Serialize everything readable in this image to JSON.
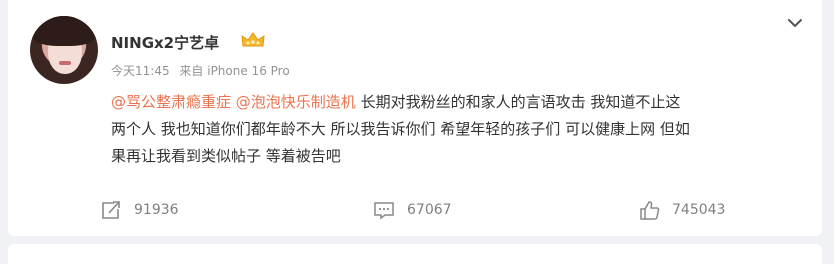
{
  "post": {
    "username": "NINGx2宁艺卓",
    "time": "今天11:45",
    "source": "来自 iPhone 16 Pro",
    "mention1": "@骂公整肃瘾重症",
    "mention2": "@泡泡快乐制造机",
    "line1_rest": " 长期对我粉丝的和家人的言语攻击 我知道不止这",
    "line2": "两个人 我也知道你们都年龄不大 所以我告诉你们 希望年轻的孩子们 可以健康上网 但如",
    "line3": "果再让我看到类似帖子 等着被告吧"
  },
  "actions": {
    "repost_count": "91936",
    "comment_count": "67067",
    "like_count": "745043"
  },
  "icons": {
    "more": "chevron-down-icon",
    "repost": "repost-icon",
    "comment": "comment-icon",
    "like": "thumbs-up-icon",
    "badge": "vip-crown-icon"
  },
  "colors": {
    "mention": "#eb7350",
    "text": "#333333",
    "meta": "#939393",
    "badge": "#f5b62c"
  }
}
